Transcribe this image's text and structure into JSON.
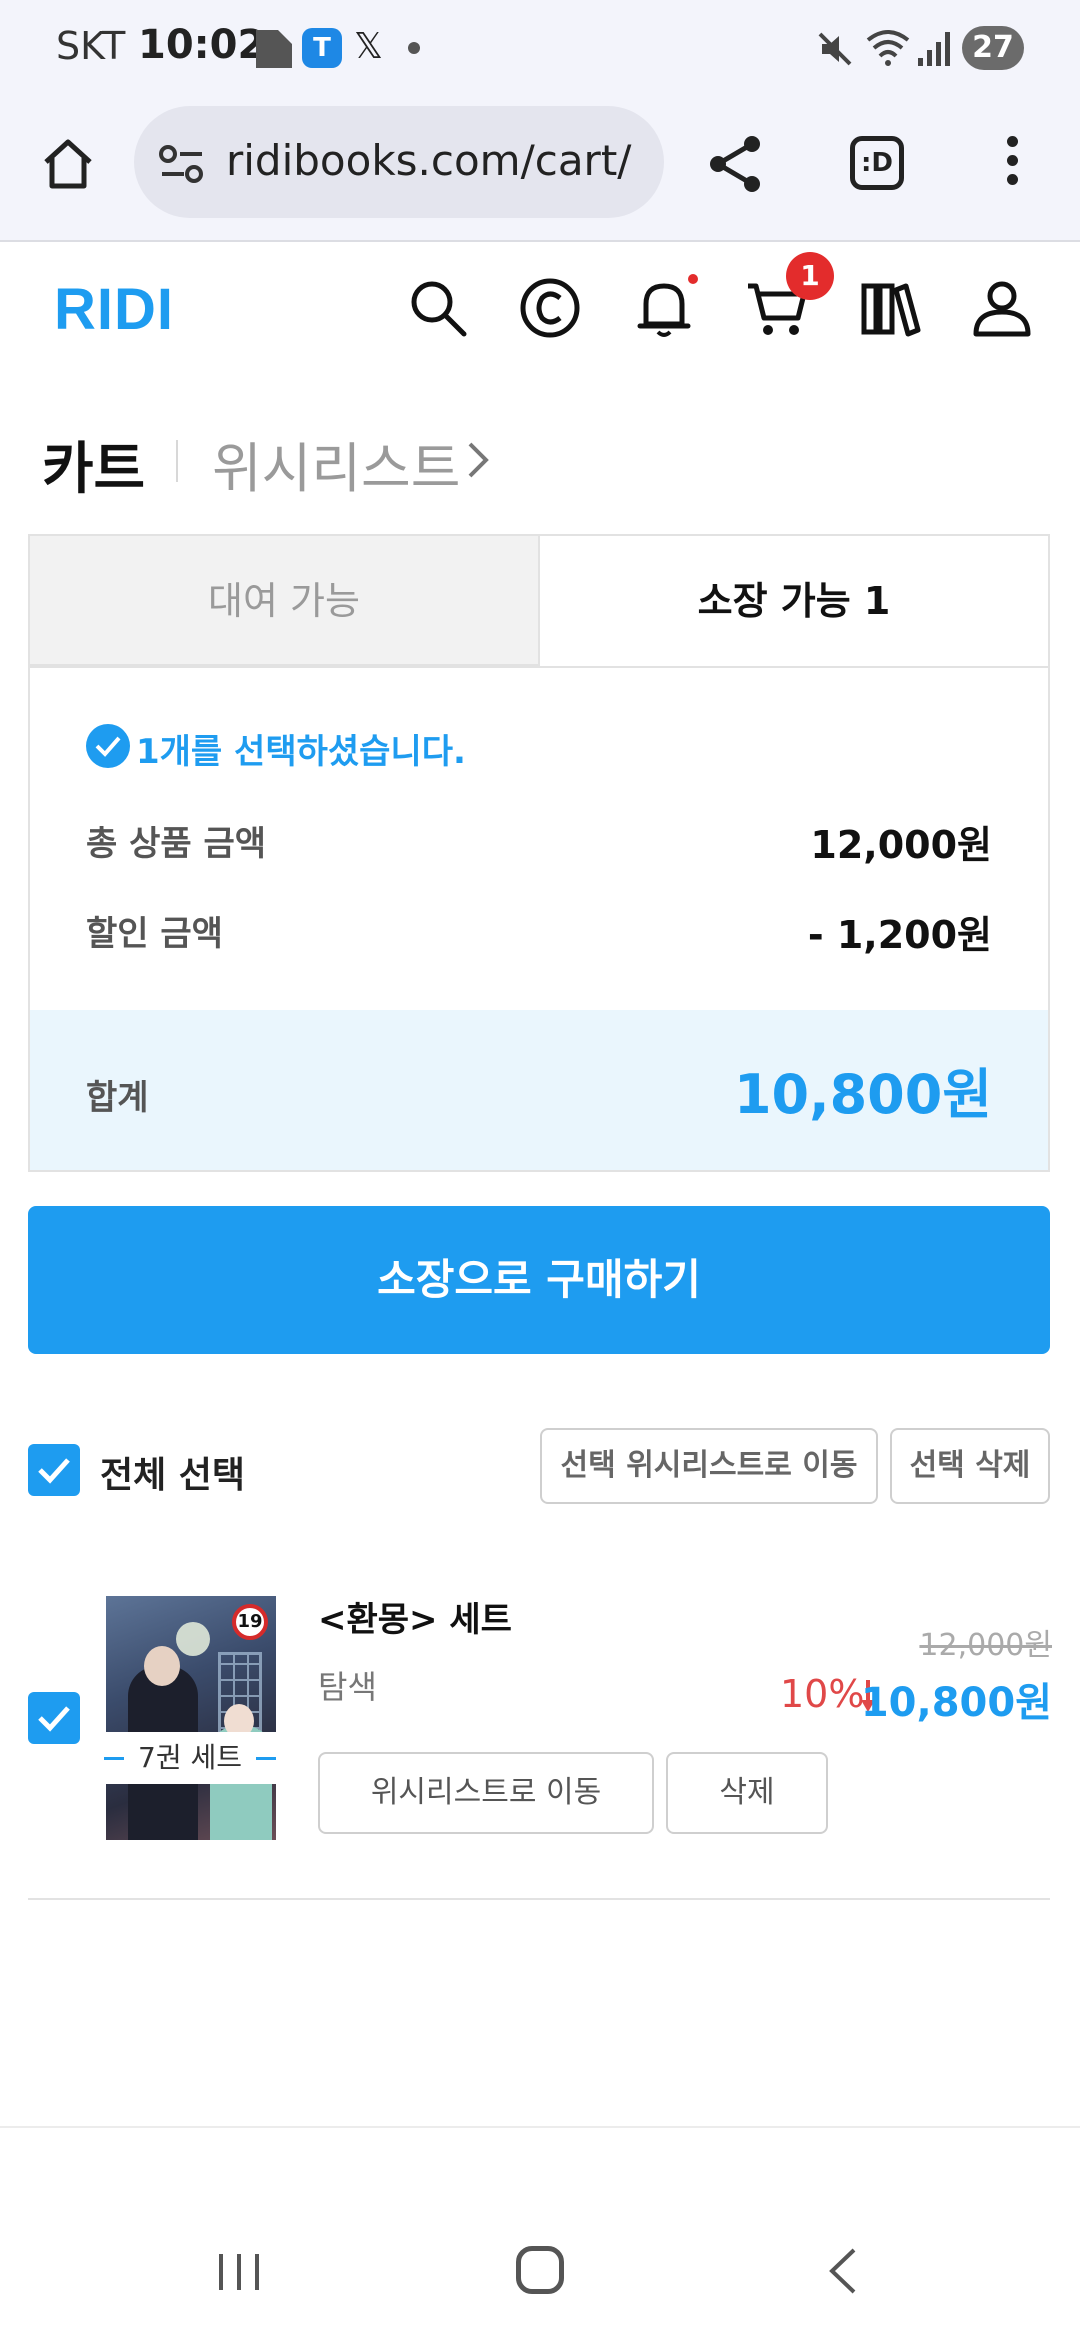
{
  "status_bar": {
    "carrier": "SKT",
    "time": "10:02",
    "battery": "27",
    "icons": [
      "document-icon",
      "t-app-icon",
      "x-icon",
      "dot-icon",
      "mute-icon",
      "wifi-icon",
      "signal-icon"
    ]
  },
  "browser": {
    "url": "ridibooks.com/cart/",
    "tab_label": ":D"
  },
  "header": {
    "logo": "RIDI",
    "cart_badge": "1",
    "icons": [
      "search-icon",
      "copyright-icon",
      "bell-icon",
      "cart-icon",
      "library-icon",
      "profile-icon"
    ]
  },
  "page_tabs": {
    "cart": "카트",
    "wishlist": "위시리스트"
  },
  "tabs": {
    "rental": "대여 가능",
    "owned": "소장 가능 1"
  },
  "summary": {
    "selected": "1개를 선택하셨습니다.",
    "subtotal_label": "총 상품 금액",
    "subtotal_value": "12,000원",
    "discount_label": "할인 금액",
    "discount_value": "- 1,200원",
    "total_label": "합계",
    "total_value": "10,800원"
  },
  "buy_button": "소장으로 구매하기",
  "select_all": {
    "label": "전체 선택",
    "move_wishlist": "선택 위시리스트로 이동",
    "delete": "선택 삭제"
  },
  "item": {
    "title": "<환몽> 세트",
    "author": "탐색",
    "set_tag": "7권 세트",
    "age_rating": "19",
    "original_price": "12,000원",
    "discount_rate": "10%",
    "final_price": "10,800원",
    "move_wishlist": "위시리스트로 이동",
    "delete": "삭제"
  },
  "colors": {
    "accent": "#1e9cf0",
    "discount": "#e04848",
    "badge": "#e32c2c"
  }
}
